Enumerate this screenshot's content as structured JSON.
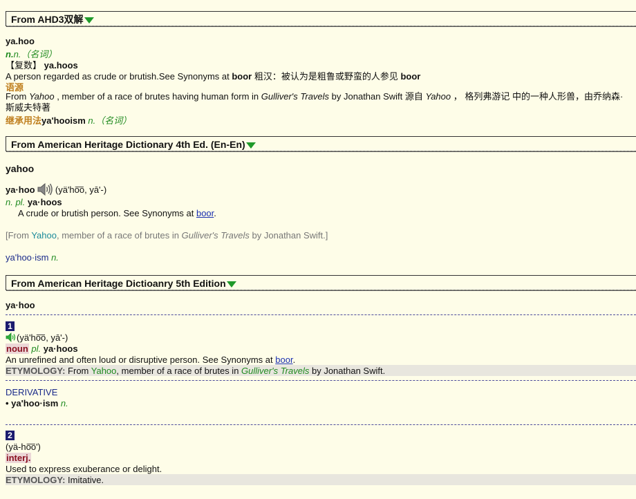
{
  "ahd3": {
    "header": "From AHD3双解",
    "headword": "ya.hoo",
    "pos": "n.（名词）",
    "plural_label": "【复数】",
    "plural": "ya.hoos",
    "def_text": "A person regarded as crude or brutish.See Synonyms at ",
    "def_bold1": "boor",
    "def_cn": " 粗汉：被认为是粗鲁或野蛮的人参见 ",
    "def_bold2": "boor",
    "origin_label": "语源",
    "origin_from": "From ",
    "origin_yahoo": "Yahoo",
    "origin_mid": " , member of a race of brutes having human form in ",
    "origin_gulliver": "Gulliver's Travels",
    "origin_by": " by Jonathan Swift  源自 ",
    "origin_yahoo2": "Yahoo",
    "origin_cn": " ， 格列弗游记 中的一种人形兽，由乔纳森·斯威夫特著",
    "derived_label": "继承用法",
    "derived_word": "ya'hooism",
    "derived_pos": " n.（名词）"
  },
  "ahd4": {
    "header": "From American Heritage Dictionary 4th Ed. (En-En)",
    "headword": "yahoo",
    "syllabic": "ya·hoo",
    "pron": "(yä'ho͞o, yā'-)",
    "pos": "n. pl.",
    "plural": "ya·hoos",
    "def_text": "A crude or brutish person. See Synonyms at ",
    "def_link": "boor",
    "def_end": ".",
    "etym_open": "[From ",
    "etym_yahoo": "Yahoo",
    "etym_mid": ", member of a race of brutes in ",
    "etym_gulliver": "Gulliver's Travels",
    "etym_end": " by Jonathan Swift.]",
    "derived_word": "ya'hoo·ism",
    "derived_pos": " n."
  },
  "ahd5": {
    "header": "From American Heritage Dictioanry 5th Edition",
    "headword": "ya·hoo",
    "sense1": {
      "number": "1",
      "pron": "(yä'ho͞o, yā'-)",
      "pos": "noun",
      "pl": "pl.",
      "plural": "ya·hoos",
      "def_text": "An unrefined and often loud or disruptive person. See Synonyms at ",
      "def_link": "boor",
      "def_end": ".",
      "etym_label": "ETYMOLOGY:",
      "etym_from": " From ",
      "etym_yahoo": "Yahoo",
      "etym_mid": ", member of a race of brutes in ",
      "etym_gulliver": "Gulliver's Travels",
      "etym_end": " by Jonathan Swift."
    },
    "derivative_label": "DERIVATIVE",
    "derivative_bullet": "• ",
    "derivative_word": "ya'hoo·ism",
    "derivative_pos": " n.",
    "sense2": {
      "number": "2",
      "pron": "(yä-ho͞o')",
      "pos": "interj.",
      "def_text": "Used to express exuberance or delight.",
      "etym_label": "ETYMOLOGY:",
      "etym_text": " Imitative."
    }
  },
  "colors": {
    "background": "#fefde8",
    "triangle": "#1f9a2a",
    "link": "#1a2fb0",
    "number_badge": "#1b1b6e",
    "pos_red": "#8a1020"
  },
  "icons": {
    "expand": "triangle-down-icon",
    "audio": "speaker-icon"
  }
}
